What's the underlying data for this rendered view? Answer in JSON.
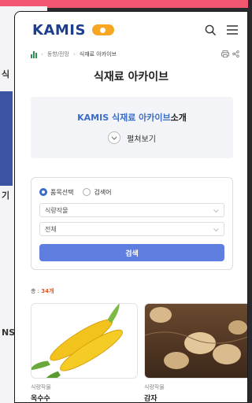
{
  "background": {
    "fragments": [
      "식",
      "기",
      "NS"
    ]
  },
  "header": {
    "logo_text": "KAMIS",
    "icons": [
      "search-icon",
      "menu-icon"
    ]
  },
  "breadcrumb": {
    "items": [
      "동향/전망",
      "식재료 아카이브"
    ],
    "tools": [
      "print-icon",
      "share-icon"
    ]
  },
  "page_title": "식재료 아카이브",
  "intro": {
    "title_blue": "KAMIS 식재료 아카이브",
    "title_dark": "소개",
    "expand_label": "펼쳐보기"
  },
  "search": {
    "radio_options": [
      {
        "label": "품목선택",
        "selected": true
      },
      {
        "label": "검색어",
        "selected": false
      }
    ],
    "select_category": "식량작물",
    "select_item": "전체",
    "button_label": "검색"
  },
  "results": {
    "count_prefix": "총 : ",
    "count_value": "34개",
    "cards": [
      {
        "category": "식량작물",
        "name": "옥수수",
        "image": "corn"
      },
      {
        "category": "식량작물",
        "name": "감자",
        "image": "potato"
      }
    ]
  },
  "colors": {
    "brand_blue": "#1d3d8f",
    "accent_blue": "#3a6cc8",
    "button_blue": "#5f7fe0",
    "count_orange": "#e2571f"
  }
}
